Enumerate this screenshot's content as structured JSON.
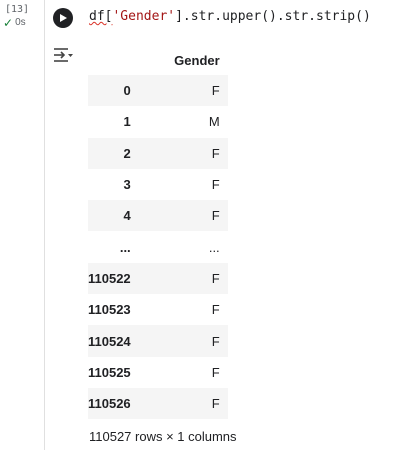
{
  "cell": {
    "execution_count": "[13]",
    "status_time": "0s",
    "code": {
      "prefix": "df[",
      "string": "'Gender'",
      "suffix": "].str.upper().str.strip()"
    }
  },
  "output": {
    "columns": [
      "Gender"
    ],
    "rows": [
      {
        "index": "0",
        "value": "F"
      },
      {
        "index": "1",
        "value": "M"
      },
      {
        "index": "2",
        "value": "F"
      },
      {
        "index": "3",
        "value": "F"
      },
      {
        "index": "4",
        "value": "F"
      },
      {
        "index": "...",
        "value": "..."
      },
      {
        "index": "110522",
        "value": "F"
      },
      {
        "index": "110523",
        "value": "F"
      },
      {
        "index": "110524",
        "value": "F"
      },
      {
        "index": "110525",
        "value": "F"
      },
      {
        "index": "110526",
        "value": "F"
      }
    ],
    "footer": "110527 rows × 1 columns"
  },
  "icons": {
    "run": "play-circle-icon",
    "status": "check-icon",
    "output": "output-actions-icon"
  }
}
